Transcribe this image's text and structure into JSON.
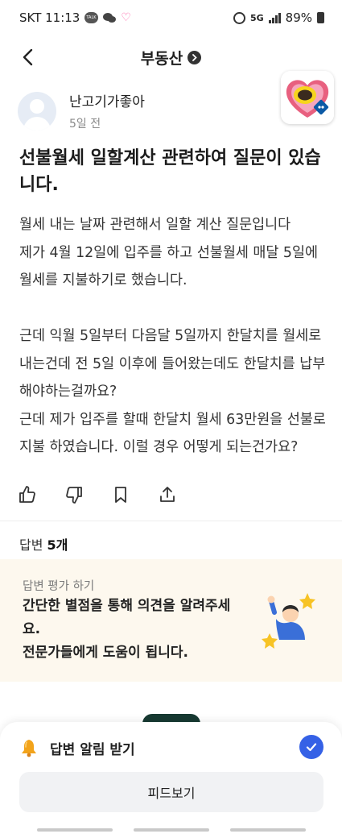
{
  "status_bar": {
    "carrier_time": "SKT 11:13",
    "network": "5G",
    "battery": "89%"
  },
  "header": {
    "title": "부동산"
  },
  "author": {
    "name": "난고기가좋아",
    "time": "5일 전"
  },
  "question": {
    "title": "선불월세 일할계산 관련하여 질문이 있습니다.",
    "body": "월세 내는 날짜 관련해서 일할 계산 질문입니다\n제가 4월 12일에 입주를 하고 선불월세 매달 5일에 월세를 지불하기로 했습니다.\n\n근데 익월 5일부터 다음달 5일까지 한달치를 월세로 내는건데 전 5일 이후에 들어왔는데도 한달치를 납부해야하는걸까요?\n근데 제가 입주를 할때 한달치 월세 63만원을 선불로 지불 하였습니다. 이럴 경우 어떻게 되는건가요?"
  },
  "actions": [
    "thumbs-up-icon",
    "thumbs-down-icon",
    "bookmark-icon",
    "share-icon"
  ],
  "answers": {
    "label": "답변",
    "count": "5개"
  },
  "rating_card": {
    "label": "답변 평가 하기",
    "text": "간단한 별점을 통해 의견을 알려주세요.\n전문가들에게 도움이 됩니다."
  },
  "bottom_sheet": {
    "notify_label": "답변 알림 받기",
    "notify_checked": true,
    "feed_button": "피드보기"
  },
  "colors": {
    "accent": "#3561e6",
    "card_bg": "#fdf8ee",
    "badge_pink": "#e8607f"
  }
}
